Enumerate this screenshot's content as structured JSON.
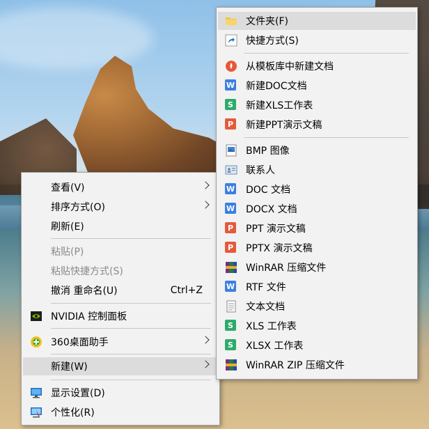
{
  "main_menu": {
    "items": [
      {
        "label": "查看(V)",
        "has_submenu": true
      },
      {
        "label": "排序方式(O)",
        "has_submenu": true
      },
      {
        "label": "刷新(E)"
      },
      {
        "label": "粘贴(P)",
        "disabled": true
      },
      {
        "label": "粘贴快捷方式(S)",
        "disabled": true
      },
      {
        "label": "撤消 重命名(U)",
        "shortcut": "Ctrl+Z"
      },
      {
        "label": "NVIDIA 控制面板",
        "icon": "nvidia-icon"
      },
      {
        "label": "360桌面助手",
        "icon": "360-icon",
        "has_submenu": true
      },
      {
        "label": "新建(W)",
        "has_submenu": true,
        "highlighted": true
      },
      {
        "label": "显示设置(D)",
        "icon": "display-icon"
      },
      {
        "label": "个性化(R)",
        "icon": "personalize-icon"
      }
    ]
  },
  "new_submenu": {
    "items": [
      {
        "label": "文件夹(F)",
        "icon": "folder-icon",
        "highlighted": true
      },
      {
        "label": "快捷方式(S)",
        "icon": "shortcut-icon"
      },
      {
        "label": "从模板库中新建文档",
        "icon": "template-icon"
      },
      {
        "label": "新建DOC文档",
        "icon": "wps-writer-icon"
      },
      {
        "label": "新建XLS工作表",
        "icon": "wps-sheet-icon"
      },
      {
        "label": "新建PPT演示文稿",
        "icon": "wps-ppt-icon"
      },
      {
        "label": "BMP 图像",
        "icon": "bmp-icon"
      },
      {
        "label": "联系人",
        "icon": "contact-icon"
      },
      {
        "label": "DOC 文档",
        "icon": "wps-writer-icon"
      },
      {
        "label": "DOCX 文档",
        "icon": "wps-writer-icon"
      },
      {
        "label": "PPT 演示文稿",
        "icon": "wps-ppt-icon"
      },
      {
        "label": "PPTX 演示文稿",
        "icon": "wps-ppt-icon"
      },
      {
        "label": "WinRAR 压缩文件",
        "icon": "winrar-icon"
      },
      {
        "label": "RTF 文件",
        "icon": "wps-writer-icon"
      },
      {
        "label": "文本文档",
        "icon": "text-document-icon"
      },
      {
        "label": "XLS 工作表",
        "icon": "wps-sheet-icon"
      },
      {
        "label": "XLSX 工作表",
        "icon": "wps-sheet-icon"
      },
      {
        "label": "WinRAR ZIP 压缩文件",
        "icon": "winrar-icon"
      }
    ]
  },
  "colors": {
    "menu_bg": "#f2f2f2",
    "highlight": "#dcdcdc",
    "wps_writer": "#3d7fe0",
    "wps_sheet": "#2dab6b",
    "wps_ppt": "#e55a3b",
    "disabled_text": "#8a8a8a"
  }
}
